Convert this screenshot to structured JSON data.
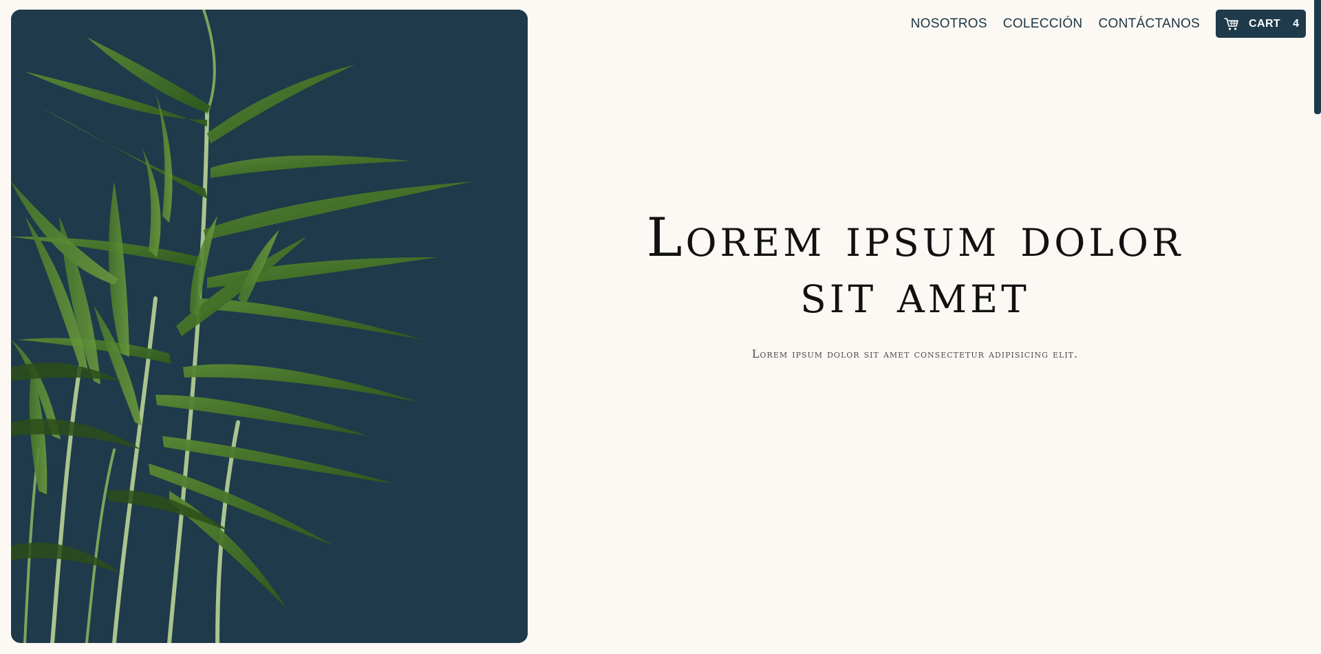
{
  "nav": {
    "links": [
      {
        "label": "NOSOTROS"
      },
      {
        "label": "COLECCIÓN"
      },
      {
        "label": "CONTÁCTANOS"
      }
    ],
    "cart": {
      "label": "CART",
      "count": "4",
      "icon": "shopping-cart-icon"
    }
  },
  "hero": {
    "headline": "Lorem ipsum dolor sit amet",
    "subtitle": "Lorem ipsum dolor sit amet consectetur adipisicing elit.",
    "image": "potted-palm-plant"
  },
  "colors": {
    "background": "#fcf8f4",
    "accent": "#1f3a4a",
    "nav_text": "#1b3441",
    "headline": "#111111",
    "leaf": "#3d6b22"
  }
}
